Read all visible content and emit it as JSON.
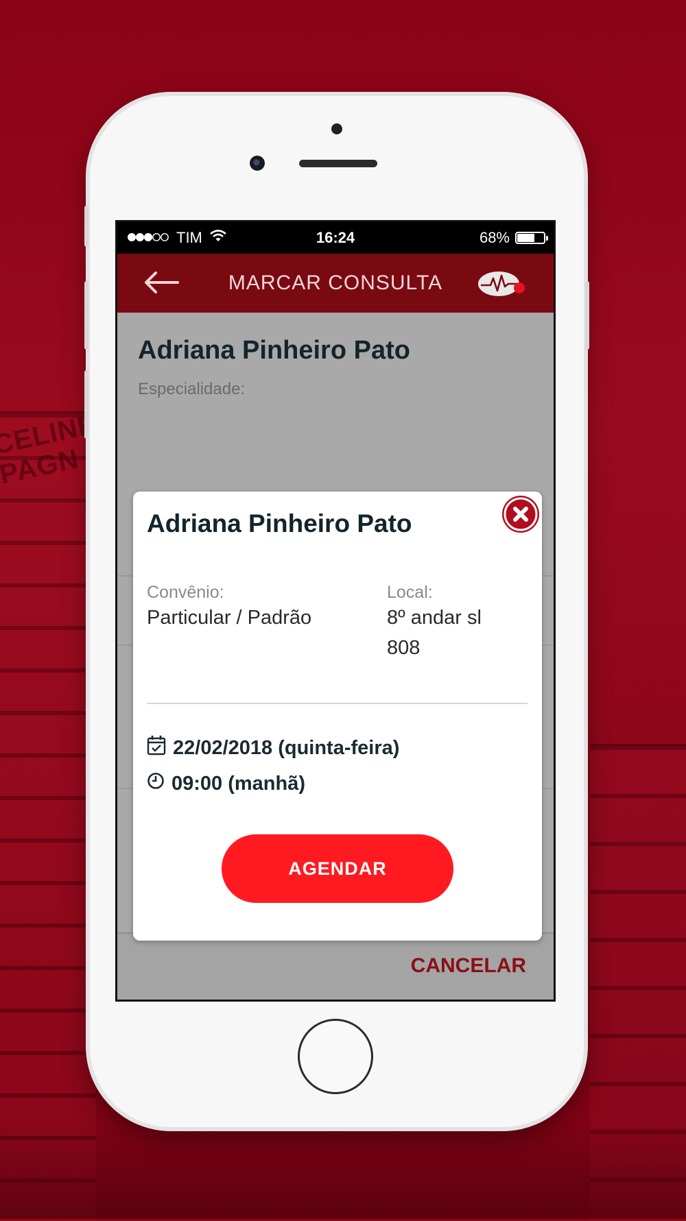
{
  "background": {
    "building_sign": "CELINE\nPAGN"
  },
  "status_bar": {
    "carrier": "TIM",
    "time": "16:24",
    "battery_percent_text": "68%",
    "battery_level": 0.68
  },
  "navbar": {
    "title": "MARCAR CONSULTA",
    "back_icon": "arrow-left-icon",
    "logo_icon": "heartbeat-logo-icon"
  },
  "background_screen": {
    "doctor_name": "Adriana Pinheiro Pato",
    "field_label": "Especialidade:",
    "cancel_label": "CANCELAR"
  },
  "modal": {
    "doctor_name": "Adriana Pinheiro Pato",
    "convenio_label": "Convênio:",
    "convenio_value": "Particular / Padrão",
    "local_label": "Local:",
    "local_value_line1": "8º andar sl",
    "local_value_line2": "808",
    "date_text": "22/02/2018 (quinta-feira)",
    "time_text": "09:00 (manhã)",
    "agendar_label": "AGENDAR",
    "close_icon": "close-icon"
  },
  "colors": {
    "background_red": "#8a0316",
    "navbar": "#7a0a12",
    "accent_button": "#ff1a22",
    "cancel_text": "#8a0f15"
  }
}
